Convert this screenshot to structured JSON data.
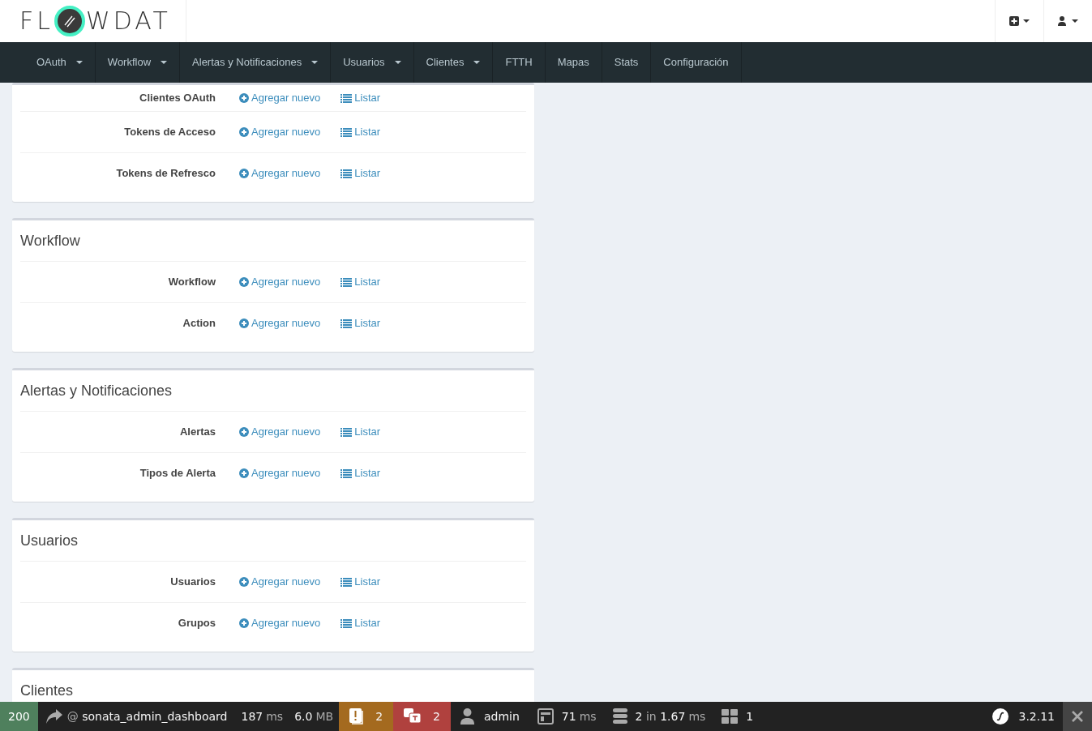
{
  "header": {
    "logo": {
      "left": "FL",
      "right": "WDAT"
    }
  },
  "nav": [
    {
      "label": "OAuth",
      "dropdown": true
    },
    {
      "label": "Workflow",
      "dropdown": true
    },
    {
      "label": "Alertas y Notificaciones",
      "dropdown": true
    },
    {
      "label": "Usuarios",
      "dropdown": true
    },
    {
      "label": "Clientes",
      "dropdown": true
    },
    {
      "label": "FTTH",
      "dropdown": false
    },
    {
      "label": "Mapas",
      "dropdown": false
    },
    {
      "label": "Stats",
      "dropdown": false
    },
    {
      "label": "Configuración",
      "dropdown": false
    }
  ],
  "panels": [
    {
      "rows": [
        {
          "label": "Clientes OAuth",
          "add": "Agregar nuevo",
          "list": "Listar"
        },
        {
          "label": "Tokens de Acceso",
          "add": "Agregar nuevo",
          "list": "Listar"
        },
        {
          "label": "Tokens de Refresco",
          "add": "Agregar nuevo",
          "list": "Listar"
        }
      ]
    },
    {
      "title": "Workflow",
      "rows": [
        {
          "label": "Workflow",
          "add": "Agregar nuevo",
          "list": "Listar"
        },
        {
          "label": "Action",
          "add": "Agregar nuevo",
          "list": "Listar"
        }
      ]
    },
    {
      "title": "Alertas y Notificaciones",
      "rows": [
        {
          "label": "Alertas",
          "add": "Agregar nuevo",
          "list": "Listar"
        },
        {
          "label": "Tipos de Alerta",
          "add": "Agregar nuevo",
          "list": "Listar"
        }
      ]
    },
    {
      "title": "Usuarios",
      "rows": [
        {
          "label": "Usuarios",
          "add": "Agregar nuevo",
          "list": "Listar"
        },
        {
          "label": "Grupos",
          "add": "Agregar nuevo",
          "list": "Listar"
        }
      ]
    },
    {
      "title": "Clientes"
    }
  ],
  "toolbar": {
    "left": [
      {
        "kind": "status",
        "value": "200"
      },
      {
        "kind": "route",
        "prefix": "@",
        "value": "sonata_admin_dashboard"
      },
      {
        "kind": "time",
        "value": "187",
        "unit": "ms"
      },
      {
        "kind": "memory",
        "value": "6.0",
        "unit": "MB"
      },
      {
        "kind": "logs",
        "value": "2",
        "color": "#a46a1f"
      },
      {
        "kind": "translation",
        "value": "2",
        "color": "#b0413e"
      },
      {
        "kind": "user",
        "value": "admin"
      },
      {
        "kind": "render",
        "value": "71",
        "unit": "ms"
      },
      {
        "kind": "db",
        "value": "2",
        "mid": "in",
        "value2": "1.67",
        "unit": "ms"
      },
      {
        "kind": "forms",
        "value": "1"
      }
    ],
    "version": "3.2.11"
  }
}
